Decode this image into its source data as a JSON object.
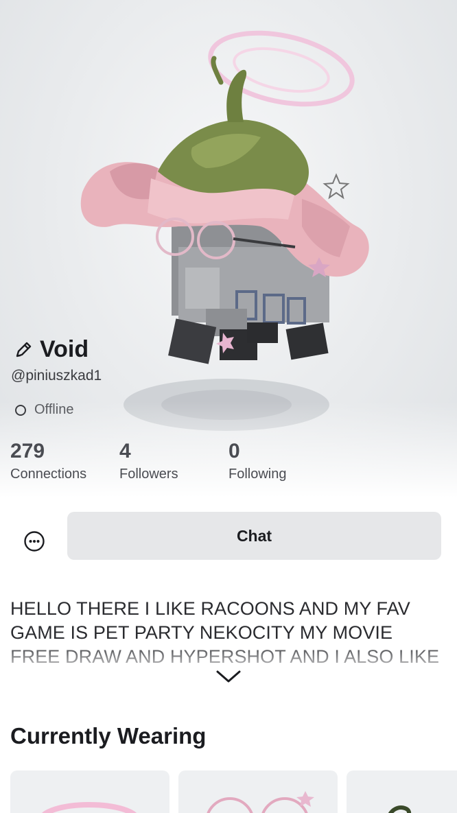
{
  "profile": {
    "display_name": "Void",
    "username": "@piniuszkad1",
    "status": "Offline"
  },
  "stats": [
    {
      "value": "279",
      "label": "Connections"
    },
    {
      "value": "4",
      "label": "Followers"
    },
    {
      "value": "0",
      "label": "Following"
    }
  ],
  "actions": {
    "chat_label": "Chat",
    "more_icon": "more-options-icon"
  },
  "bio": {
    "text": "HELLO THERE I LIKE RACOONS AND MY FAV GAME IS PET PARTY NEKOCITY MY MOVIE FREE DRAW AND HYPERSHOT AND I ALSO  LIKE"
  },
  "wearing": {
    "title": "Currently Wearing",
    "items": [
      "pink-halo-item",
      "round-glasses-item",
      "vine-item"
    ]
  },
  "icons": {
    "edit": "pencil-icon",
    "status": "status-circle-icon",
    "expand": "chevron-down-icon"
  },
  "colors": {
    "chat_button_bg": "#e6e7e9",
    "text_primary": "#1b1c20",
    "text_secondary": "#4a4c52"
  }
}
